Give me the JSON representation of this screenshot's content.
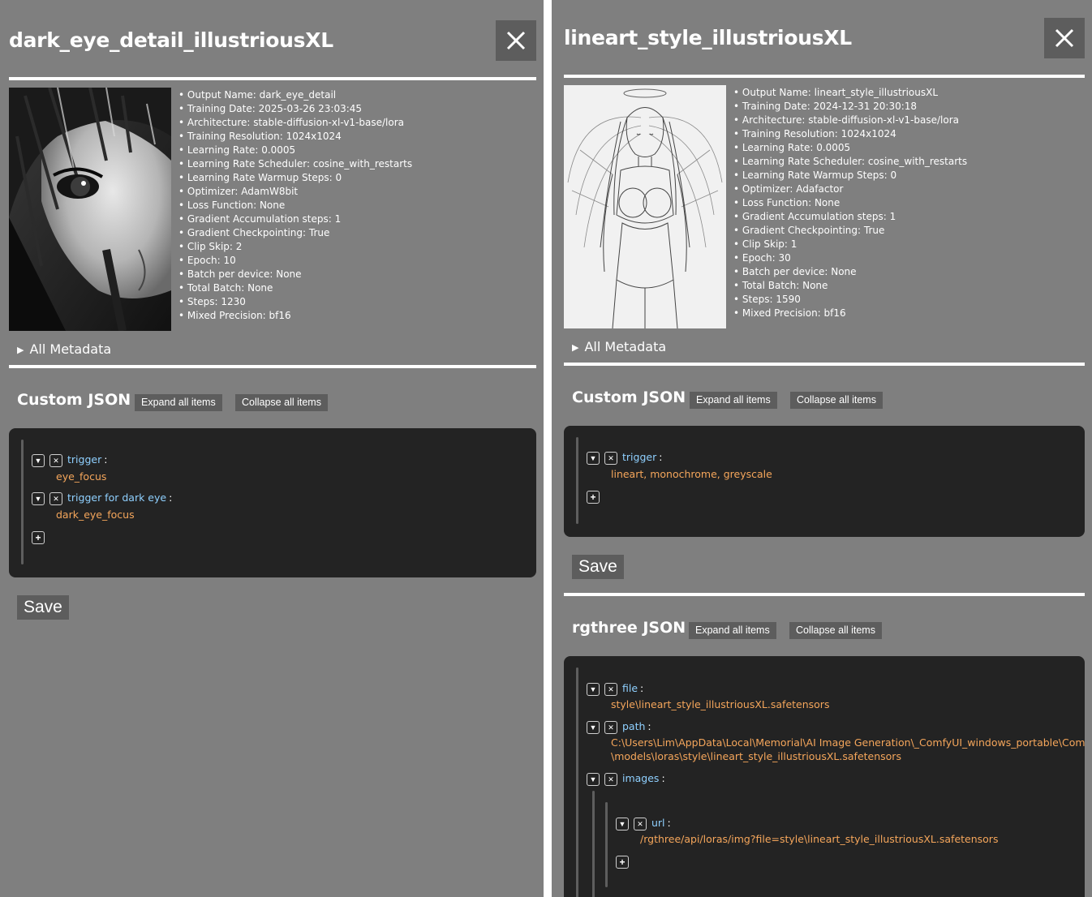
{
  "left": {
    "title": "dark_eye_detail_illustriousXL",
    "metadata": [
      "Output Name: dark_eye_detail",
      "Training Date: 2025-03-26 23:03:45",
      "Architecture: stable-diffusion-xl-v1-base/lora",
      "Training Resolution: 1024x1024",
      "Learning Rate: 0.0005",
      "Learning Rate Scheduler: cosine_with_restarts",
      "Learning Rate Warmup Steps: 0",
      "Optimizer: AdamW8bit",
      "Loss Function: None",
      "Gradient Accumulation steps: 1",
      "Gradient Checkpointing: True",
      "Clip Skip: 2",
      "Epoch: 10",
      "Batch per device: None",
      "Total Batch: None",
      "Steps: 1230",
      "Mixed Precision: bf16"
    ],
    "all_metadata_label": "All Metadata",
    "custom_json": {
      "title": "Custom JSON",
      "expand_label": "Expand all items",
      "collapse_label": "Collapse all items",
      "entries": [
        {
          "key": "trigger",
          "value": "eye_focus"
        },
        {
          "key": "trigger for dark eye",
          "value": "dark_eye_focus"
        }
      ]
    },
    "save_label": "Save"
  },
  "right": {
    "title": "lineart_style_illustriousXL",
    "metadata": [
      "Output Name: lineart_style_illustriousXL",
      "Training Date: 2024-12-31 20:30:18",
      "Architecture: stable-diffusion-xl-v1-base/lora",
      "Training Resolution: 1024x1024",
      "Learning Rate: 0.0005",
      "Learning Rate Scheduler: cosine_with_restarts",
      "Learning Rate Warmup Steps: 0",
      "Optimizer: Adafactor",
      "Loss Function: None",
      "Gradient Accumulation steps: 1",
      "Gradient Checkpointing: True",
      "Clip Skip: 1",
      "Epoch: 30",
      "Batch per device: None",
      "Total Batch: None",
      "Steps: 1590",
      "Mixed Precision: bf16"
    ],
    "all_metadata_label": "All Metadata",
    "custom_json": {
      "title": "Custom JSON",
      "expand_label": "Expand all items",
      "collapse_label": "Collapse all items",
      "entries": [
        {
          "key": "trigger",
          "value": "lineart, monochrome, greyscale"
        }
      ]
    },
    "save_label": "Save",
    "rgthree_json": {
      "title": "rgthree JSON",
      "expand_label": "Expand all items",
      "collapse_label": "Collapse all items",
      "file": {
        "key": "file",
        "value": "style\\lineart_style_illustriousXL.safetensors"
      },
      "path": {
        "key": "path",
        "value_line1": "C:\\Users\\Lim\\AppData\\Local\\Memorial\\AI Image Generation\\_ComfyUI_windows_portable\\ComfyUI",
        "value_line2": "\\models\\loras\\style\\lineart_style_illustriousXL.safetensors"
      },
      "images": {
        "key": "images",
        "url": {
          "key": "url",
          "value": "/rgthree/api/loras/img?file=style\\lineart_style_illustriousXL.safetensors"
        }
      }
    }
  },
  "icons": {
    "close": "close-icon",
    "expand": "chevron-down-icon",
    "remove": "remove-icon",
    "add": "plus-icon",
    "disclosure": "disclosure-triangle-icon"
  }
}
